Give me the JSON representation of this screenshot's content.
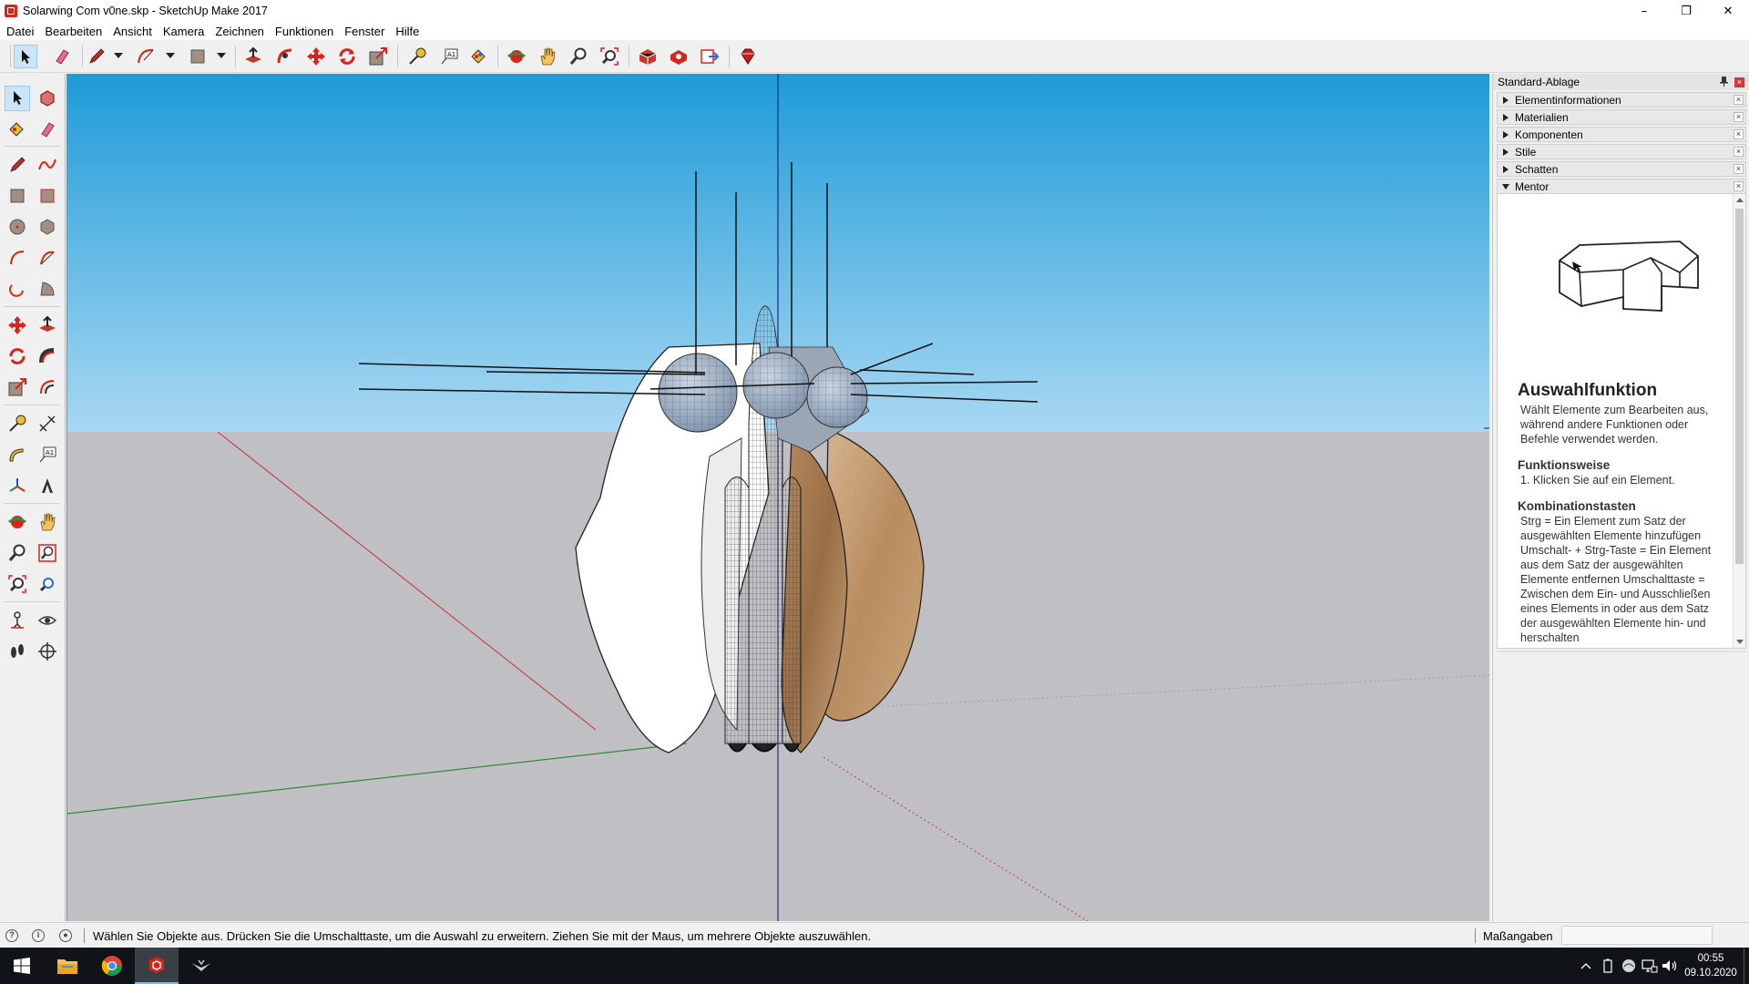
{
  "window": {
    "title": "Solarwing Com v0ne.skp - SketchUp Make 2017",
    "minimize": "–",
    "maximize": "❐",
    "close": "✕"
  },
  "menu": [
    "Datei",
    "Bearbeiten",
    "Ansicht",
    "Kamera",
    "Zeichnen",
    "Funktionen",
    "Fenster",
    "Hilfe"
  ],
  "tray": {
    "title": "Standard-Ablage",
    "panels": [
      "Elementinformationen",
      "Materialien",
      "Komponenten",
      "Stile",
      "Schatten"
    ],
    "mentor_panel": "Mentor",
    "close_glyph": "×"
  },
  "mentor": {
    "heading": "Auswahlfunktion",
    "description": "Wählt Elemente zum Bearbeiten aus, während andere Funktionen oder Befehle verwendet werden.",
    "how_heading": "Funktionsweise",
    "how_text": "1. Klicken Sie auf ein Element.",
    "keys_heading": "Kombinationstasten",
    "keys_text": "Strg = Ein Element zum Satz der ausgewählten Elemente hinzufügen Umschalt- + Strg-Taste = Ein Element aus dem Satz der ausgewählten Elemente entfernen Umschalttaste = Zwischen dem Ein- und Ausschließen eines Elements in oder aus dem Satz der ausgewählten Elemente hin- und herschalten"
  },
  "statusbar": {
    "hint": "Wählen Sie Objekte aus. Drücken Sie die Umschalttaste, um die Auswahl zu erweitern. Ziehen Sie mit der Maus, um mehrere Objekte auszuwählen.",
    "measurements_label": "Maßangaben",
    "measurements_value": "",
    "icon_geo": "?",
    "icon_info": "i",
    "icon_user": "●"
  },
  "taskbar": {
    "time": "00:55",
    "date": "09.10.2020",
    "apps": [
      "start-icon",
      "file-explorer-icon",
      "chrome-icon",
      "sketchup-icon",
      "wing-app-icon"
    ]
  },
  "colors": {
    "sky_top": "#1e9bd8",
    "sky_bottom": "#a8d8f2",
    "ground": "#c0c0c4",
    "accent_red": "#d9241b",
    "selection": "#cce4f7"
  }
}
